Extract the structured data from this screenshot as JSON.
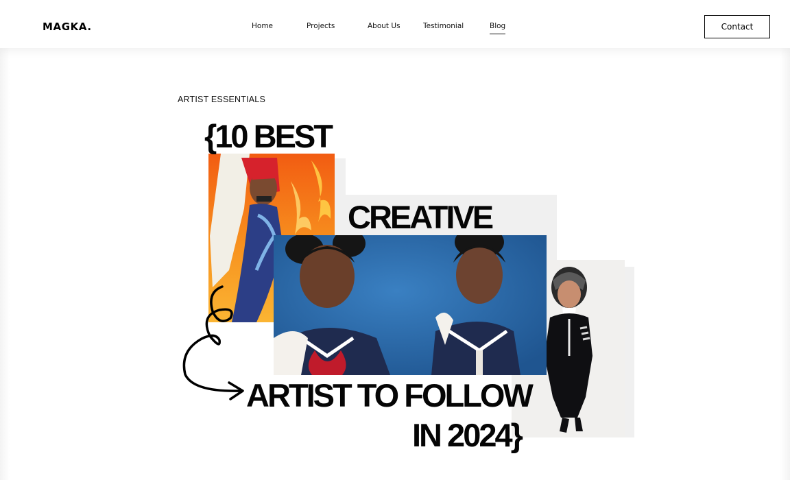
{
  "brand": {
    "logo": "MAGKA."
  },
  "nav": {
    "items": [
      {
        "label": "Home",
        "active": false
      },
      {
        "label": "Projects",
        "active": false
      },
      {
        "label": "About Us",
        "active": false
      },
      {
        "label": "Testimonial",
        "active": false
      },
      {
        "label": "Blog",
        "active": true
      }
    ],
    "contact_label": "Contact"
  },
  "article": {
    "category": "ARTIST ESSENTIALS",
    "headline": {
      "line1": "{10 BEST",
      "line2": "CREATIVE",
      "line3": "ARTIST TO FOLLOW",
      "line4": "IN 2024}"
    }
  },
  "colors": {
    "text": "#050505",
    "header_bg": "#ffffff",
    "collage_gray": "#f0f0f0",
    "fire_orange": "#f58a1f",
    "sky_blue": "#2c6aa8"
  }
}
